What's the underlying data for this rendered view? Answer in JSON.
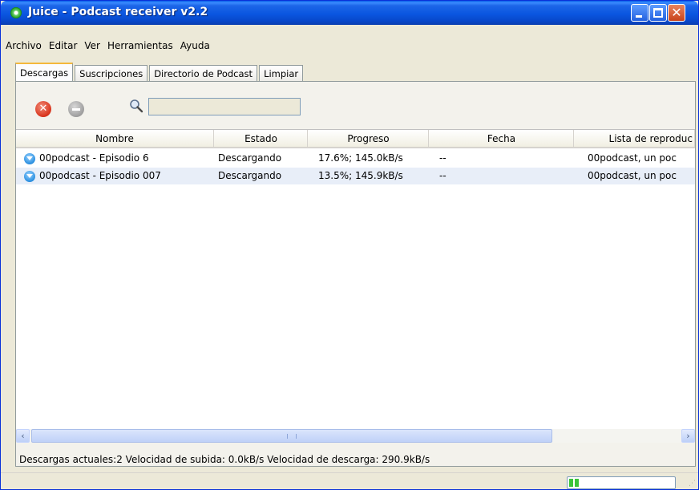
{
  "window": {
    "title": "Juice - Podcast receiver v2.2",
    "titlebar_color": "#0a56e0"
  },
  "menu": [
    "Archivo",
    "Editar",
    "Ver",
    "Herramientas",
    "Ayuda"
  ],
  "tabs": [
    {
      "label": "Descargas",
      "active": true
    },
    {
      "label": "Suscripciones",
      "active": false
    },
    {
      "label": "Directorio de Podcast",
      "active": false
    },
    {
      "label": "Limpiar",
      "active": false
    }
  ],
  "toolbar": {
    "remove_icon": "remove-icon",
    "minus_icon": "minus-icon",
    "search_icon": "search-icon",
    "search_value": ""
  },
  "table": {
    "columns": [
      "Nombre",
      "Estado",
      "Progreso",
      "Fecha",
      "Lista de reproduc"
    ],
    "rows": [
      {
        "nombre": "00podcast - Episodio 6",
        "estado": "Descargando",
        "progreso": "17.6%; 145.0kB/s",
        "fecha": "--",
        "lista": "00podcast, un poc"
      },
      {
        "nombre": "00podcast - Episodio 007",
        "estado": "Descargando",
        "progreso": "13.5%; 145.9kB/s",
        "fecha": "--",
        "lista": "00podcast, un poc"
      }
    ]
  },
  "status": {
    "text": "Descargas actuales:2 Velocidad de subida: 0.0kB/s Velocidad de descarga: 290.9kB/s",
    "meter_level": 0.1,
    "meter_color": "#3ac43a"
  }
}
